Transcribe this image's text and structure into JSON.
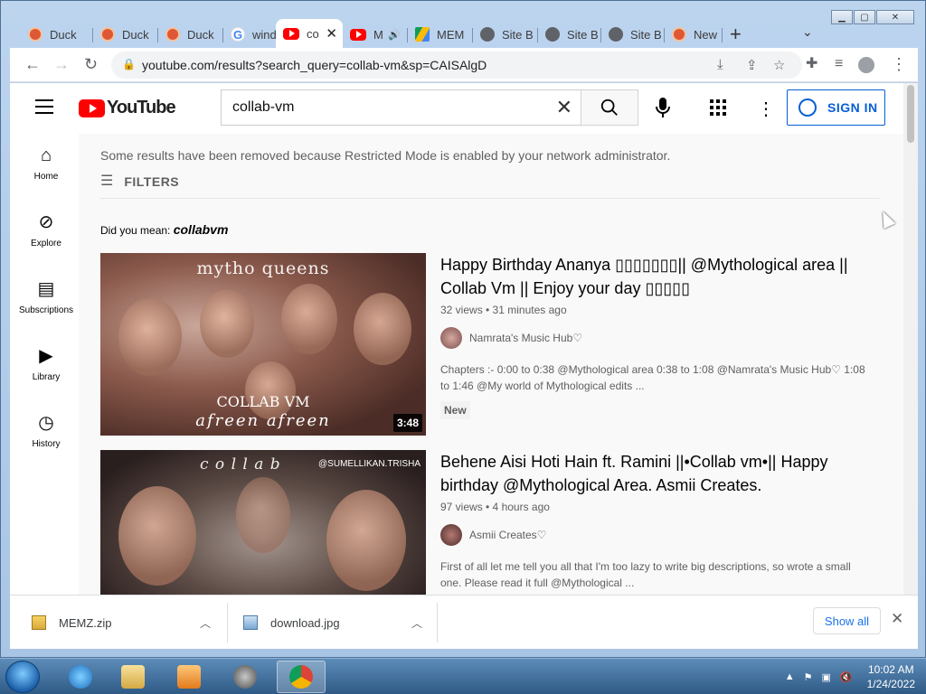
{
  "browser": {
    "tabs": [
      {
        "label": "Duck",
        "favicon": "duckduckgo-icon"
      },
      {
        "label": "Duck",
        "favicon": "duckduckgo-icon"
      },
      {
        "label": "Duck",
        "favicon": "duckduckgo-icon"
      },
      {
        "label": "windo",
        "favicon": "google-icon"
      },
      {
        "label": "co",
        "favicon": "youtube-icon",
        "active": true
      },
      {
        "label": "M",
        "favicon": "youtube-icon",
        "audio": true
      },
      {
        "label": "MEM",
        "favicon": "google-drive-icon"
      },
      {
        "label": "Site B",
        "favicon": "globe-icon"
      },
      {
        "label": "Site B",
        "favicon": "globe-icon"
      },
      {
        "label": "Site B",
        "favicon": "globe-icon"
      },
      {
        "label": "New",
        "favicon": "duckduckgo-icon"
      }
    ],
    "url": "youtube.com/results?search_query=collab-vm&sp=CAISAlgD"
  },
  "youtube": {
    "logo_text": "YouTube",
    "search_value": "collab-vm",
    "sign_in": "SIGN IN",
    "guide": [
      {
        "label": "Home",
        "icon": "home-icon"
      },
      {
        "label": "Explore",
        "icon": "compass-icon"
      },
      {
        "label": "Subscriptions",
        "icon": "subscriptions-icon"
      },
      {
        "label": "Library",
        "icon": "library-icon"
      },
      {
        "label": "History",
        "icon": "history-icon"
      }
    ],
    "notice": "Some results have been removed because Restricted Mode is enabled by your network administrator.",
    "filters": "FILTERS",
    "did_you_mean": "Did you mean:",
    "did_you_mean_query": "collabvm",
    "videos": [
      {
        "title": "Happy Birthday Ananya ▯▯▯▯▯▯▯|| @Mythological area || Collab Vm || Enjoy your day ▯▯▯▯▯",
        "stats": "32 views • 31 minutes ago",
        "channel": "Namrata's Music Hub♡",
        "description": "Chapters :- 0:00 to 0:38 @Mythological area 0:38 to 1:08 @Namrata's Music Hub♡ 1:08 to 1:46 @My world of Mythological edits ...",
        "badge": "New",
        "duration": "3:48",
        "thumb_text_top": "mytho queens",
        "thumb_text_mid": "COLLAB VM",
        "thumb_text_bottom": "afreen afreen"
      },
      {
        "title": "Behene Aisi Hoti Hain ft. Ramini ||•Collab vm•|| Happy birthday @Mythological Area. Asmii Creates.",
        "stats": "97 views • 4 hours ago",
        "channel": "Asmii Creates♡",
        "description": "First of all let me tell you all that I'm too lazy to write big descriptions, so wrote a small one. Please read it full @Mythological ...",
        "thumb_text_top": "c o l l a b",
        "thumb_handle": "@SUMELLIKAN.TRISHA"
      }
    ]
  },
  "downloads": {
    "items": [
      "MEMZ.zip",
      "download.jpg"
    ],
    "show_all": "Show all"
  },
  "taskbar": {
    "time": "10:02 AM",
    "date": "1/24/2022"
  }
}
